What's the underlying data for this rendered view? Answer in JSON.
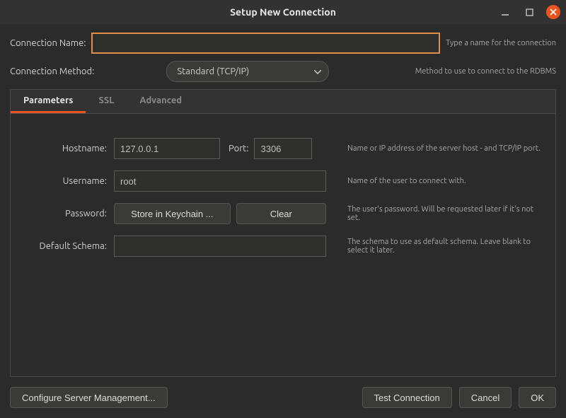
{
  "window": {
    "title": "Setup New Connection"
  },
  "conn_name": {
    "label": "Connection Name:",
    "value": "",
    "hint": "Type a name for the connection"
  },
  "conn_method": {
    "label": "Connection Method:",
    "value": "Standard (TCP/IP)",
    "hint": "Method to use to connect to the RDBMS"
  },
  "tabs": {
    "parameters": "Parameters",
    "ssl": "SSL",
    "advanced": "Advanced"
  },
  "form": {
    "hostname": {
      "label": "Hostname:",
      "value": "127.0.0.1",
      "port_label": "Port:",
      "port_value": "3306",
      "desc": "Name or IP address of the server host - and TCP/IP port."
    },
    "username": {
      "label": "Username:",
      "value": "root",
      "desc": "Name of the user to connect with."
    },
    "password": {
      "label": "Password:",
      "store_btn": "Store in Keychain ...",
      "clear_btn": "Clear",
      "desc": "The user's password. Will be requested later if it's not set."
    },
    "schema": {
      "label": "Default Schema:",
      "value": "",
      "desc": "The schema to use as default schema. Leave blank to select it later."
    }
  },
  "footer": {
    "configure": "Configure Server Management...",
    "test": "Test Connection",
    "cancel": "Cancel",
    "ok": "OK"
  }
}
